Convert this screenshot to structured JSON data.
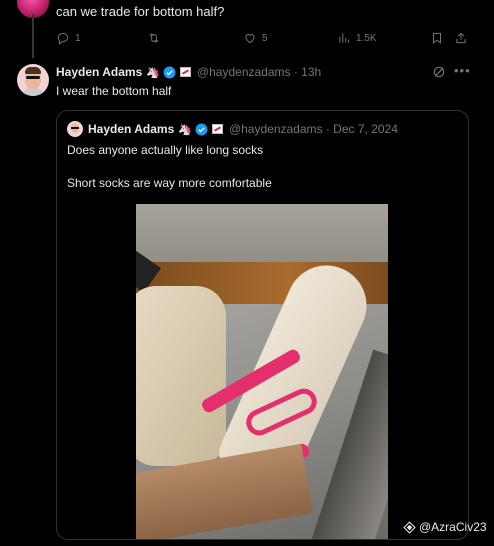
{
  "previous_reply": {
    "text": "can we trade for bottom half?"
  },
  "actions": {
    "reply_count": "1",
    "like_count": "5",
    "view_count": "1.5K"
  },
  "tweet": {
    "author_name": "Hayden Adams",
    "handle_time": "@haydenzadams · 13h",
    "text": "I wear the bottom half"
  },
  "quoted": {
    "author_name": "Hayden Adams",
    "handle_time": "@haydenzadams · Dec 7, 2024",
    "line1": "Does anyone actually like long socks",
    "line2": "Short socks are way more comfortable"
  },
  "watermark": {
    "text": "@AzraCiv23"
  },
  "icons": {
    "reply": "reply-icon",
    "retweet": "retweet-icon",
    "like": "heart-icon",
    "views": "views-icon",
    "bookmark": "bookmark-icon",
    "share": "share-icon",
    "verified": "verified-badge-icon",
    "unicorn": "unicorn-emoji-icon",
    "grok": "grok-icon",
    "more": "more-icon"
  },
  "colors": {
    "background": "#000000",
    "text": "#e7e9ea",
    "muted": "#71767b",
    "verified": "#1d9bf0",
    "border": "#2f3336"
  }
}
